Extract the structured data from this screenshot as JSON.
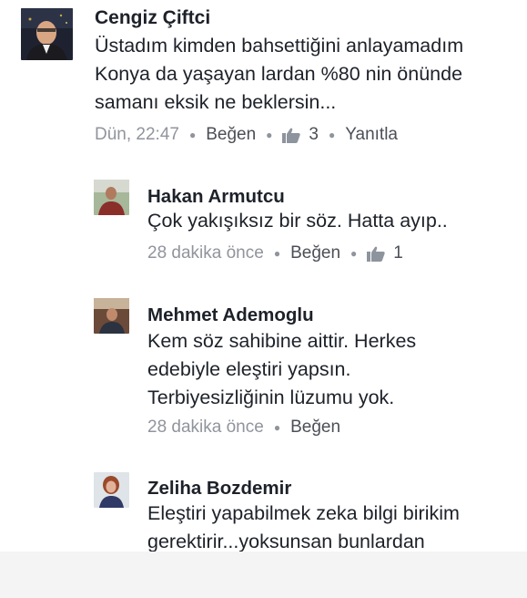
{
  "comments": [
    {
      "author": "Cengiz Çiftci",
      "lines": [
        "Üstadım kimden bahsettiğini anlayamadım",
        "Konya da yaşayan lardan %80 nin önünde",
        "samanı eksik ne beklersin..."
      ],
      "time": "Dün, 22:47",
      "like_label": "Beğen",
      "like_count": "3",
      "reply_label": "Yanıtla",
      "avatar_icon": "person-photo-icon"
    },
    {
      "author": "Hakan Armutcu",
      "lines": [
        "Çok yakışıksız bir söz. Hatta ayıp.."
      ],
      "time": "28 dakika önce",
      "like_label": "Beğen",
      "like_count": "1",
      "avatar_icon": "person-photo-icon"
    },
    {
      "author": "Mehmet Ademoglu",
      "lines": [
        "Kem söz sahibine aittir. Herkes",
        "edebiyle eleştiri yapsın.",
        "Terbiyesizliğinin lüzumu yok."
      ],
      "time": "28 dakika önce",
      "like_label": "Beğen",
      "avatar_icon": "person-photo-icon"
    },
    {
      "author": "Zeliha Bozdemir",
      "lines": [
        "Eleştiri yapabilmek zeka bilgi birikim",
        "gerektirir...yoksunsan bunlardan"
      ],
      "avatar_icon": "person-photo-icon"
    }
  ],
  "colors": {
    "meta_text": "#90949c",
    "link_text": "#4b4f56",
    "like_icon": "#8d949e"
  }
}
